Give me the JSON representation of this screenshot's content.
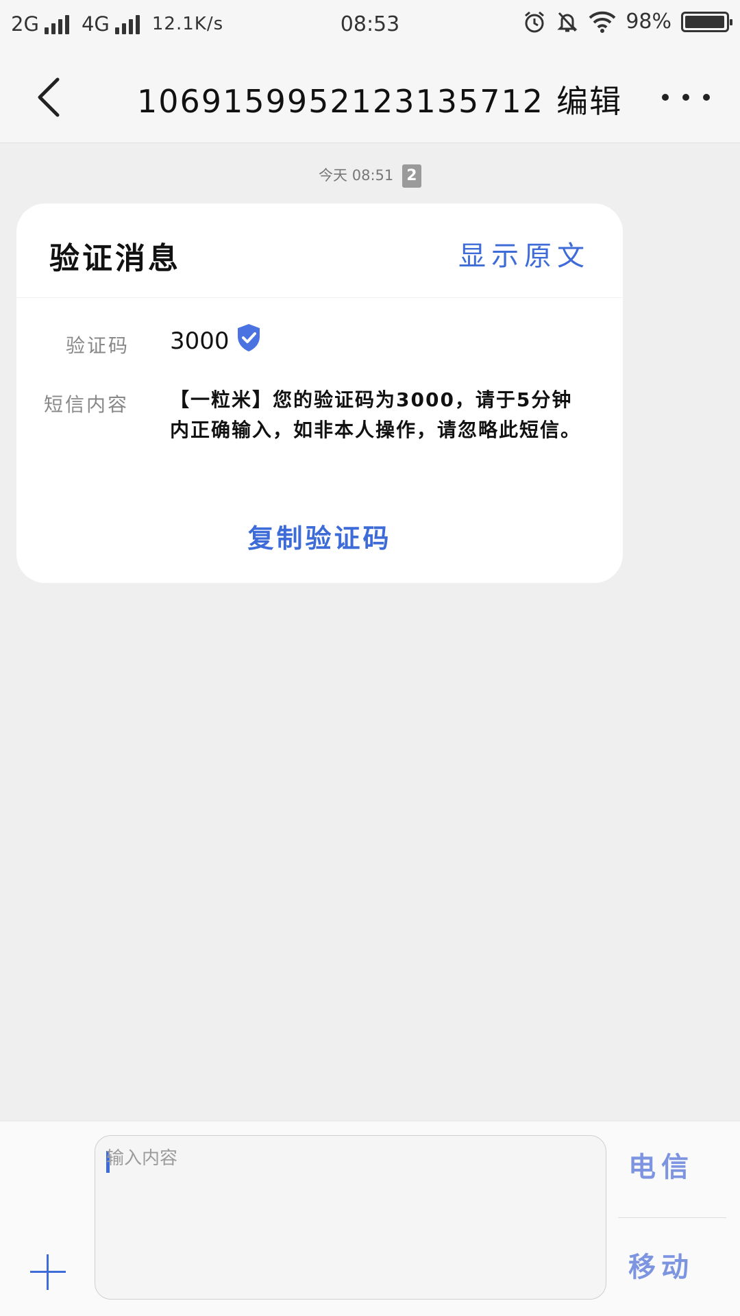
{
  "status_bar": {
    "net1": "2G",
    "net2": "4G",
    "speed": "12.1K/s",
    "time": "08:53",
    "battery": "98%",
    "battery_level": 0.98,
    "icons": [
      "alarm-icon",
      "bell-off-icon",
      "wifi-icon",
      "battery-icon"
    ]
  },
  "header": {
    "title": "1069159952123135712",
    "edit": "编辑"
  },
  "message": {
    "time": "今天 08:51",
    "sim": "2"
  },
  "card": {
    "title": "验证消息",
    "show_original": "显示原文",
    "code_label": "验证码",
    "code_value": "3000",
    "content_label": "短信内容",
    "content_text": "【一粒米】您的验证码为3000，请于5分钟内正确输入，如非本人操作，请忽略此短信。",
    "copy_button": "复制验证码"
  },
  "composer": {
    "placeholder": "输入内容",
    "send_option_1": "电信",
    "send_option_2": "移动"
  },
  "colors": {
    "accent": "#3d6bd8",
    "verified": "#4a72e0"
  }
}
